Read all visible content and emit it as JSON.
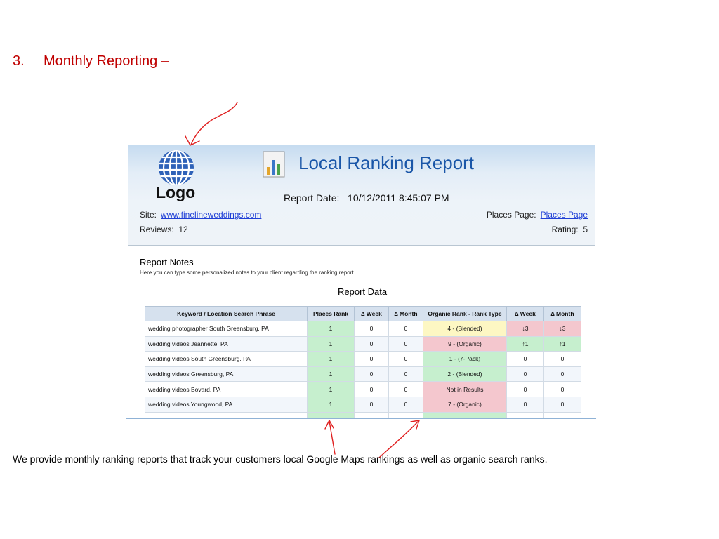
{
  "section": {
    "number": "3.",
    "title": "Monthly Reporting –"
  },
  "report": {
    "logo_text": "Logo",
    "title": "Local Ranking Report",
    "report_date_label": "Report Date:",
    "report_date_value": "10/12/2011 8:45:07 PM",
    "site_label": "Site:",
    "site_url": "www.finelineweddings.com",
    "places_label": "Places Page:",
    "places_link": "Places Page",
    "reviews_label": "Reviews:",
    "reviews_value": "12",
    "rating_label": "Rating:",
    "rating_value": "5",
    "notes_title": "Report Notes",
    "notes_text": "Here you can type some personalized notes to your client regarding the ranking report",
    "data_title": "Report Data",
    "columns": [
      "Keyword / Location Search Phrase",
      "Places Rank",
      "∆ Week",
      "∆ Month",
      "Organic Rank - Rank Type",
      "∆ Week",
      "∆ Month"
    ],
    "rows": [
      {
        "keyword": "wedding photographer South Greensburg, PA",
        "places_rank": "1",
        "p_week": "0",
        "p_month": "0",
        "organic": "4 - (Blended)",
        "o_week": "↓3",
        "o_month": "↓3"
      },
      {
        "keyword": "wedding videos Jeannette, PA",
        "places_rank": "1",
        "p_week": "0",
        "p_month": "0",
        "organic": "9 - (Organic)",
        "o_week": "↑1",
        "o_month": "↑1"
      },
      {
        "keyword": "wedding videos South Greensburg, PA",
        "places_rank": "1",
        "p_week": "0",
        "p_month": "0",
        "organic": "1 - (7-Pack)",
        "o_week": "0",
        "o_month": "0"
      },
      {
        "keyword": "wedding videos Greensburg, PA",
        "places_rank": "1",
        "p_week": "0",
        "p_month": "0",
        "organic": "2 - (Blended)",
        "o_week": "0",
        "o_month": "0"
      },
      {
        "keyword": "wedding videos Bovard, PA",
        "places_rank": "1",
        "p_week": "0",
        "p_month": "0",
        "organic": "Not in Results",
        "o_week": "0",
        "o_month": "0"
      },
      {
        "keyword": "wedding videos Youngwood, PA",
        "places_rank": "1",
        "p_week": "0",
        "p_month": "0",
        "organic": "7 - (Organic)",
        "o_week": "0",
        "o_month": "0"
      }
    ]
  },
  "caption": "We provide monthly ranking reports that track your customers local Google Maps rankings as well as organic search ranks.",
  "colors": {
    "heading": "#c00000",
    "title_blue": "#1a56a8",
    "green_cell": "#c6efce",
    "red_cell": "#f4c7ce",
    "yellow_cell": "#fdf7c3",
    "arrow_red": "#e02020"
  }
}
